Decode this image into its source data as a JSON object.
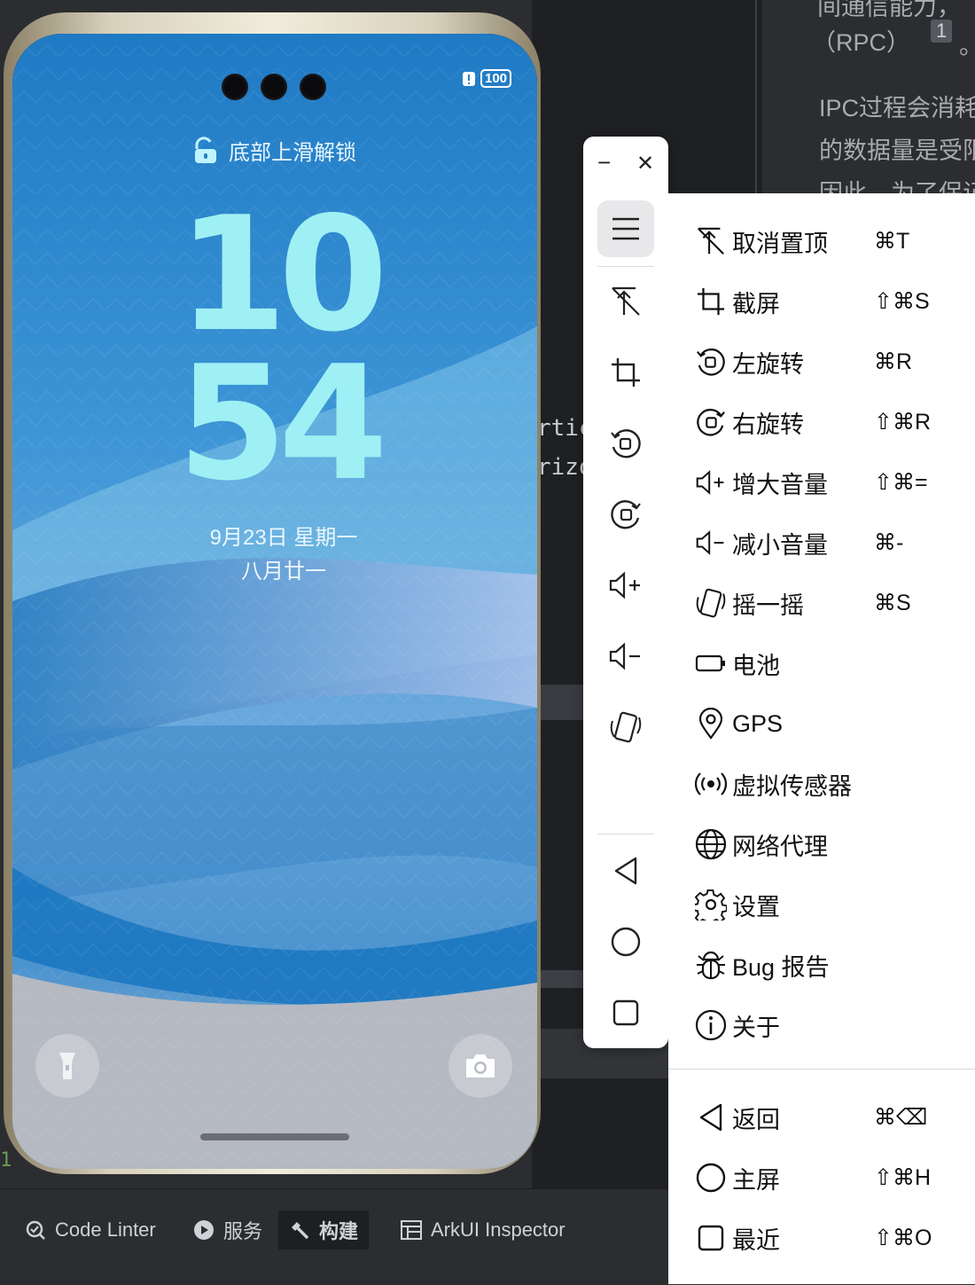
{
  "ide": {
    "doc_lines": [
      "间通信能力，",
      "（RPC）",
      "1",
      "。",
      "IPC过程会消耗",
      "的数据量是受限",
      "因此，为了保证"
    ],
    "code_fragments": [
      "rtic",
      "rizo"
    ],
    "gutter_line": "1",
    "bottom_tabs": [
      {
        "label": "Code Linter",
        "icon": "code-linter-icon"
      },
      {
        "label": "服务",
        "icon": "play-service-icon"
      },
      {
        "label": "构建",
        "icon": "hammer-icon"
      },
      {
        "label": "ArkUI Inspector",
        "icon": "inspector-icon"
      }
    ]
  },
  "phone": {
    "battery": "100",
    "unlock_hint": "底部上滑解锁",
    "hour": "10",
    "minute": "54",
    "date": "9月23日  星期一",
    "lunar_date": "八月廿一",
    "wallpaper_color": "#3a8fd0"
  },
  "toolbar": {
    "minimize": "−",
    "close": "✕",
    "buttons": [
      "menu-icon",
      "unpin-icon",
      "crop-icon",
      "rotate-left-icon",
      "rotate-right-icon",
      "volume-up-icon",
      "volume-down-icon",
      "shake-icon",
      "back-icon",
      "home-icon",
      "recents-icon"
    ]
  },
  "menu": {
    "items": [
      {
        "label": "取消置顶",
        "shortcut": "⌘T",
        "icon": "unpin-icon"
      },
      {
        "label": "截屏",
        "shortcut": "⇧⌘S",
        "icon": "crop-icon"
      },
      {
        "label": "左旋转",
        "shortcut": "⌘R",
        "icon": "rotate-left-icon"
      },
      {
        "label": "右旋转",
        "shortcut": "⇧⌘R",
        "icon": "rotate-right-icon"
      },
      {
        "label": "增大音量",
        "shortcut": "⇧⌘=",
        "icon": "volume-up-icon"
      },
      {
        "label": "减小音量",
        "shortcut": "⌘-",
        "icon": "volume-down-icon"
      },
      {
        "label": "摇一摇",
        "shortcut": "⌘S",
        "icon": "shake-icon"
      },
      {
        "label": "电池",
        "shortcut": "",
        "icon": "battery-icon"
      },
      {
        "label": "GPS",
        "shortcut": "",
        "icon": "location-pin-icon"
      },
      {
        "label": "虚拟传感器",
        "shortcut": "",
        "icon": "sensor-icon"
      },
      {
        "label": "网络代理",
        "shortcut": "",
        "icon": "globe-icon"
      },
      {
        "label": "设置",
        "shortcut": "",
        "icon": "gear-icon"
      },
      {
        "label": "Bug 报告",
        "shortcut": "",
        "icon": "bug-icon"
      },
      {
        "label": "关于",
        "shortcut": "",
        "icon": "info-icon"
      }
    ],
    "nav_items": [
      {
        "label": "返回",
        "shortcut": "⌘⌫",
        "icon": "back-icon"
      },
      {
        "label": "主屏",
        "shortcut": "⇧⌘H",
        "icon": "home-icon"
      },
      {
        "label": "最近",
        "shortcut": "⇧⌘O",
        "icon": "recents-icon"
      }
    ]
  }
}
